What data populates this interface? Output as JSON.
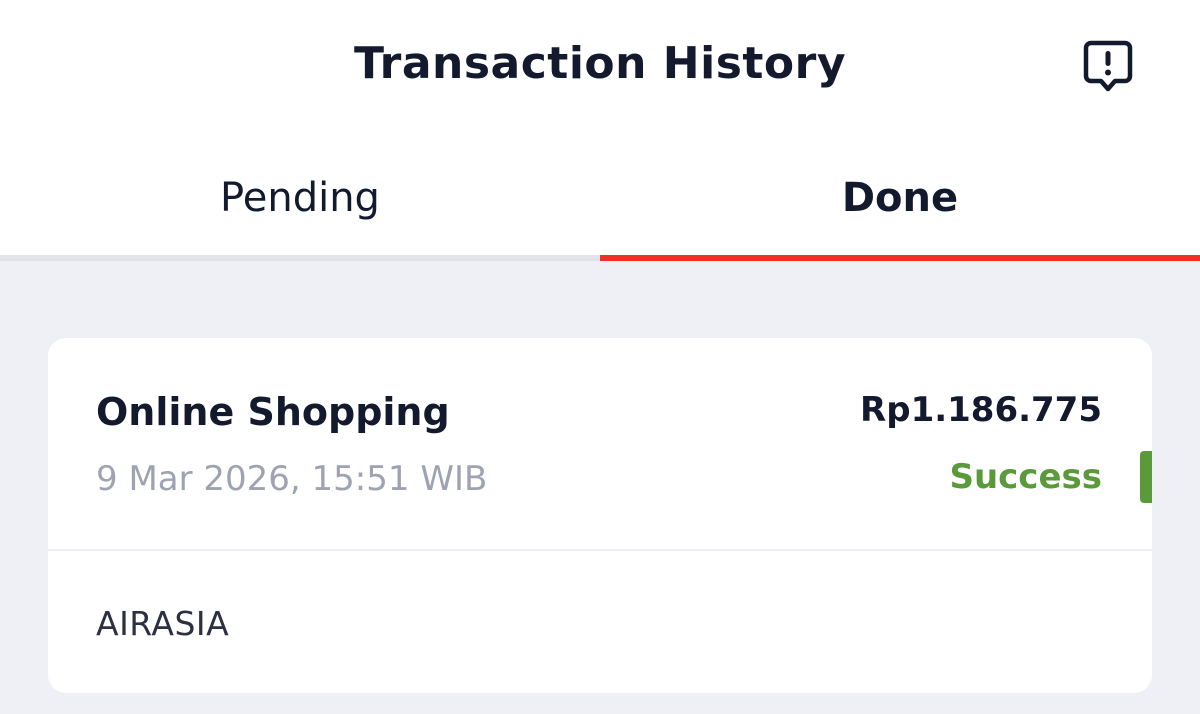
{
  "header": {
    "title": "Transaction History",
    "report_icon": "report-exclamation-icon"
  },
  "tabs": [
    {
      "label": "Pending",
      "active": false
    },
    {
      "label": "Done",
      "active": true
    }
  ],
  "colors": {
    "accent": "#ee3124",
    "success": "#5a9a3a",
    "background": "#eef0f5",
    "text_primary": "#131a2e",
    "text_secondary": "#9ea3b2"
  },
  "transactions": [
    {
      "title": "Online Shopping",
      "datetime": "9 Mar 2026, 15:51 WIB",
      "amount": "Rp1.186.775",
      "status": "Success",
      "merchant": "AIRASIA"
    }
  ]
}
